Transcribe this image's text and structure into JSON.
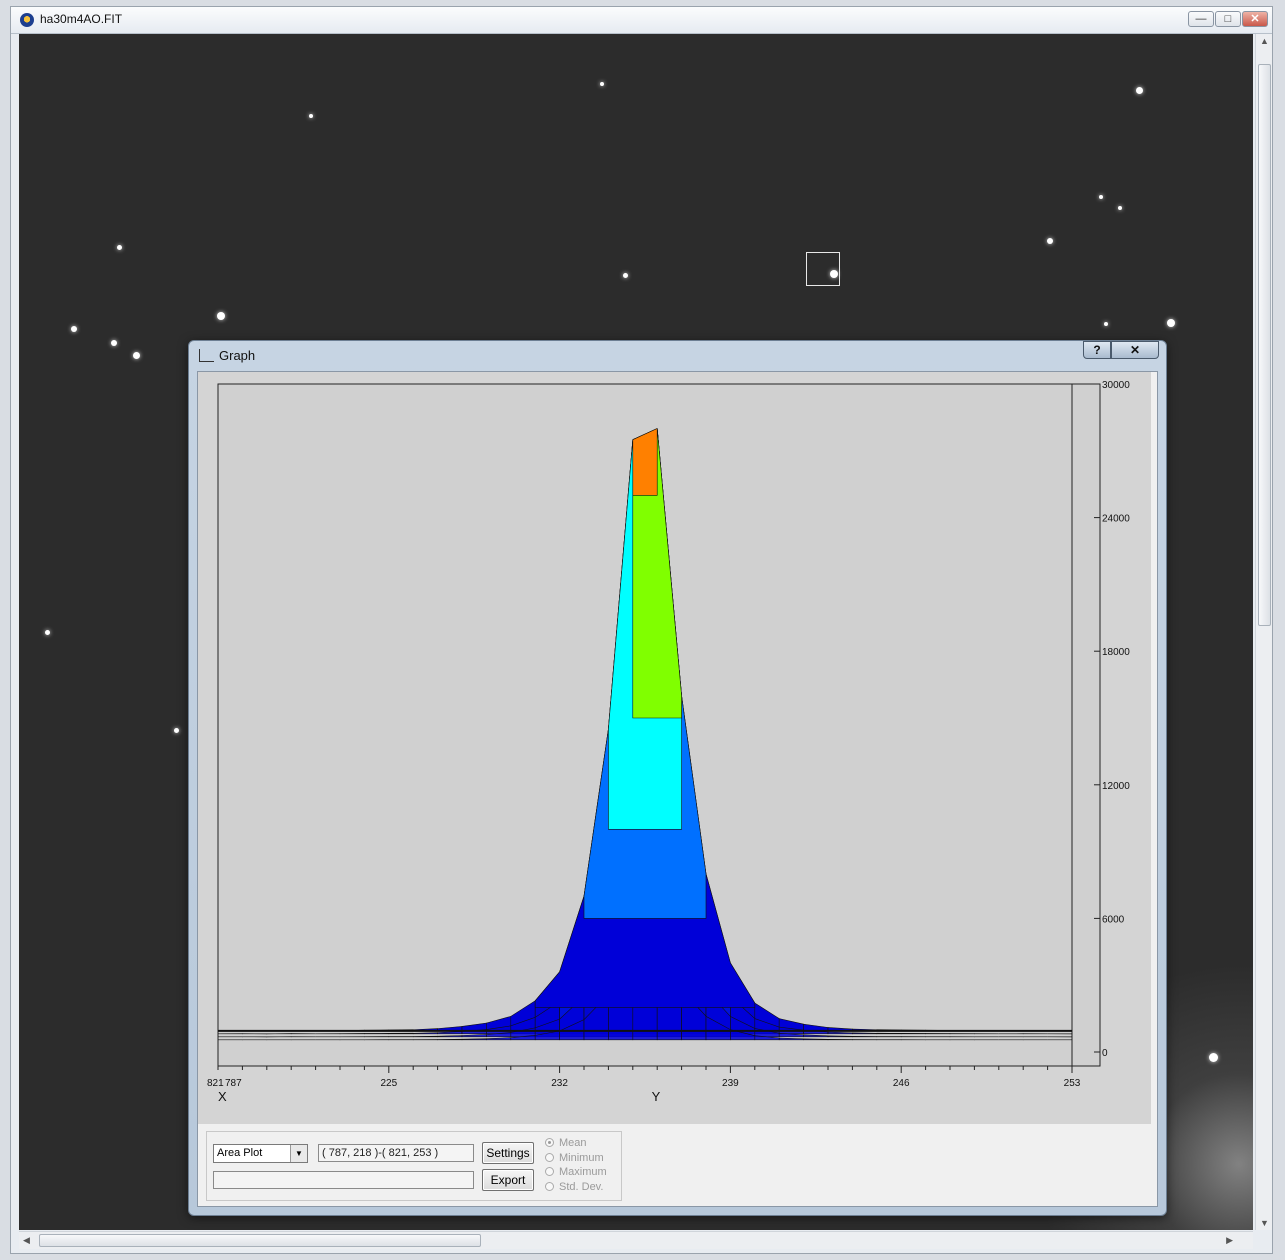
{
  "window": {
    "title": "ha30m4AO.FIT",
    "min_icon": "minimize-icon",
    "max_icon": "maximize-icon",
    "close_icon": "close-icon"
  },
  "graph_window": {
    "title": "Graph",
    "help_label": "?",
    "close_label": "✕"
  },
  "controls": {
    "plot_type": "Area Plot",
    "region": "( 787, 218 )-( 821, 253 )",
    "status_text": "",
    "settings_label": "Settings",
    "export_label": "Export",
    "radios": [
      {
        "label": "Mean",
        "selected": true
      },
      {
        "label": "Minimum",
        "selected": false
      },
      {
        "label": "Maximum",
        "selected": false
      },
      {
        "label": "Std. Dev.",
        "selected": false
      }
    ]
  },
  "chart_data": {
    "type": "area",
    "title": "",
    "xlabel": "X",
    "ylabel": "Y",
    "x_tick_labels": [
      "821",
      "787"
    ],
    "y_ticks": [
      225,
      232,
      239,
      246,
      253
    ],
    "y_tick_labels": [
      "225",
      "232",
      "239",
      "246",
      "253"
    ],
    "z_ticks": [
      0,
      6000,
      12000,
      18000,
      24000,
      30000
    ],
    "z_tick_labels": [
      "0",
      "6000",
      "12000",
      "18000",
      "24000",
      "30000"
    ],
    "zlim": [
      0,
      30000
    ],
    "ylim": [
      218,
      253
    ],
    "color_scale": [
      "#0000d8",
      "#0070ff",
      "#00ffff",
      "#80ff00",
      "#ffff00",
      "#ff8000",
      "#ff0000"
    ],
    "series": [
      {
        "y": [
          218,
          219,
          220,
          221,
          222,
          223,
          224,
          225,
          226,
          227,
          228,
          229,
          230,
          231,
          232,
          233,
          234,
          235,
          236,
          237,
          238,
          239,
          240,
          241,
          242,
          243,
          244,
          245,
          246,
          247,
          248,
          249,
          250,
          251,
          252,
          253
        ],
        "values": [
          950,
          960,
          940,
          970,
          950,
          960,
          980,
          990,
          1000,
          1050,
          1150,
          1300,
          1600,
          2300,
          3600,
          7000,
          14500,
          27500,
          28000,
          16000,
          8000,
          4000,
          2200,
          1500,
          1250,
          1100,
          1030,
          1000,
          990,
          980,
          970,
          960,
          950,
          960,
          950,
          940
        ]
      }
    ]
  }
}
